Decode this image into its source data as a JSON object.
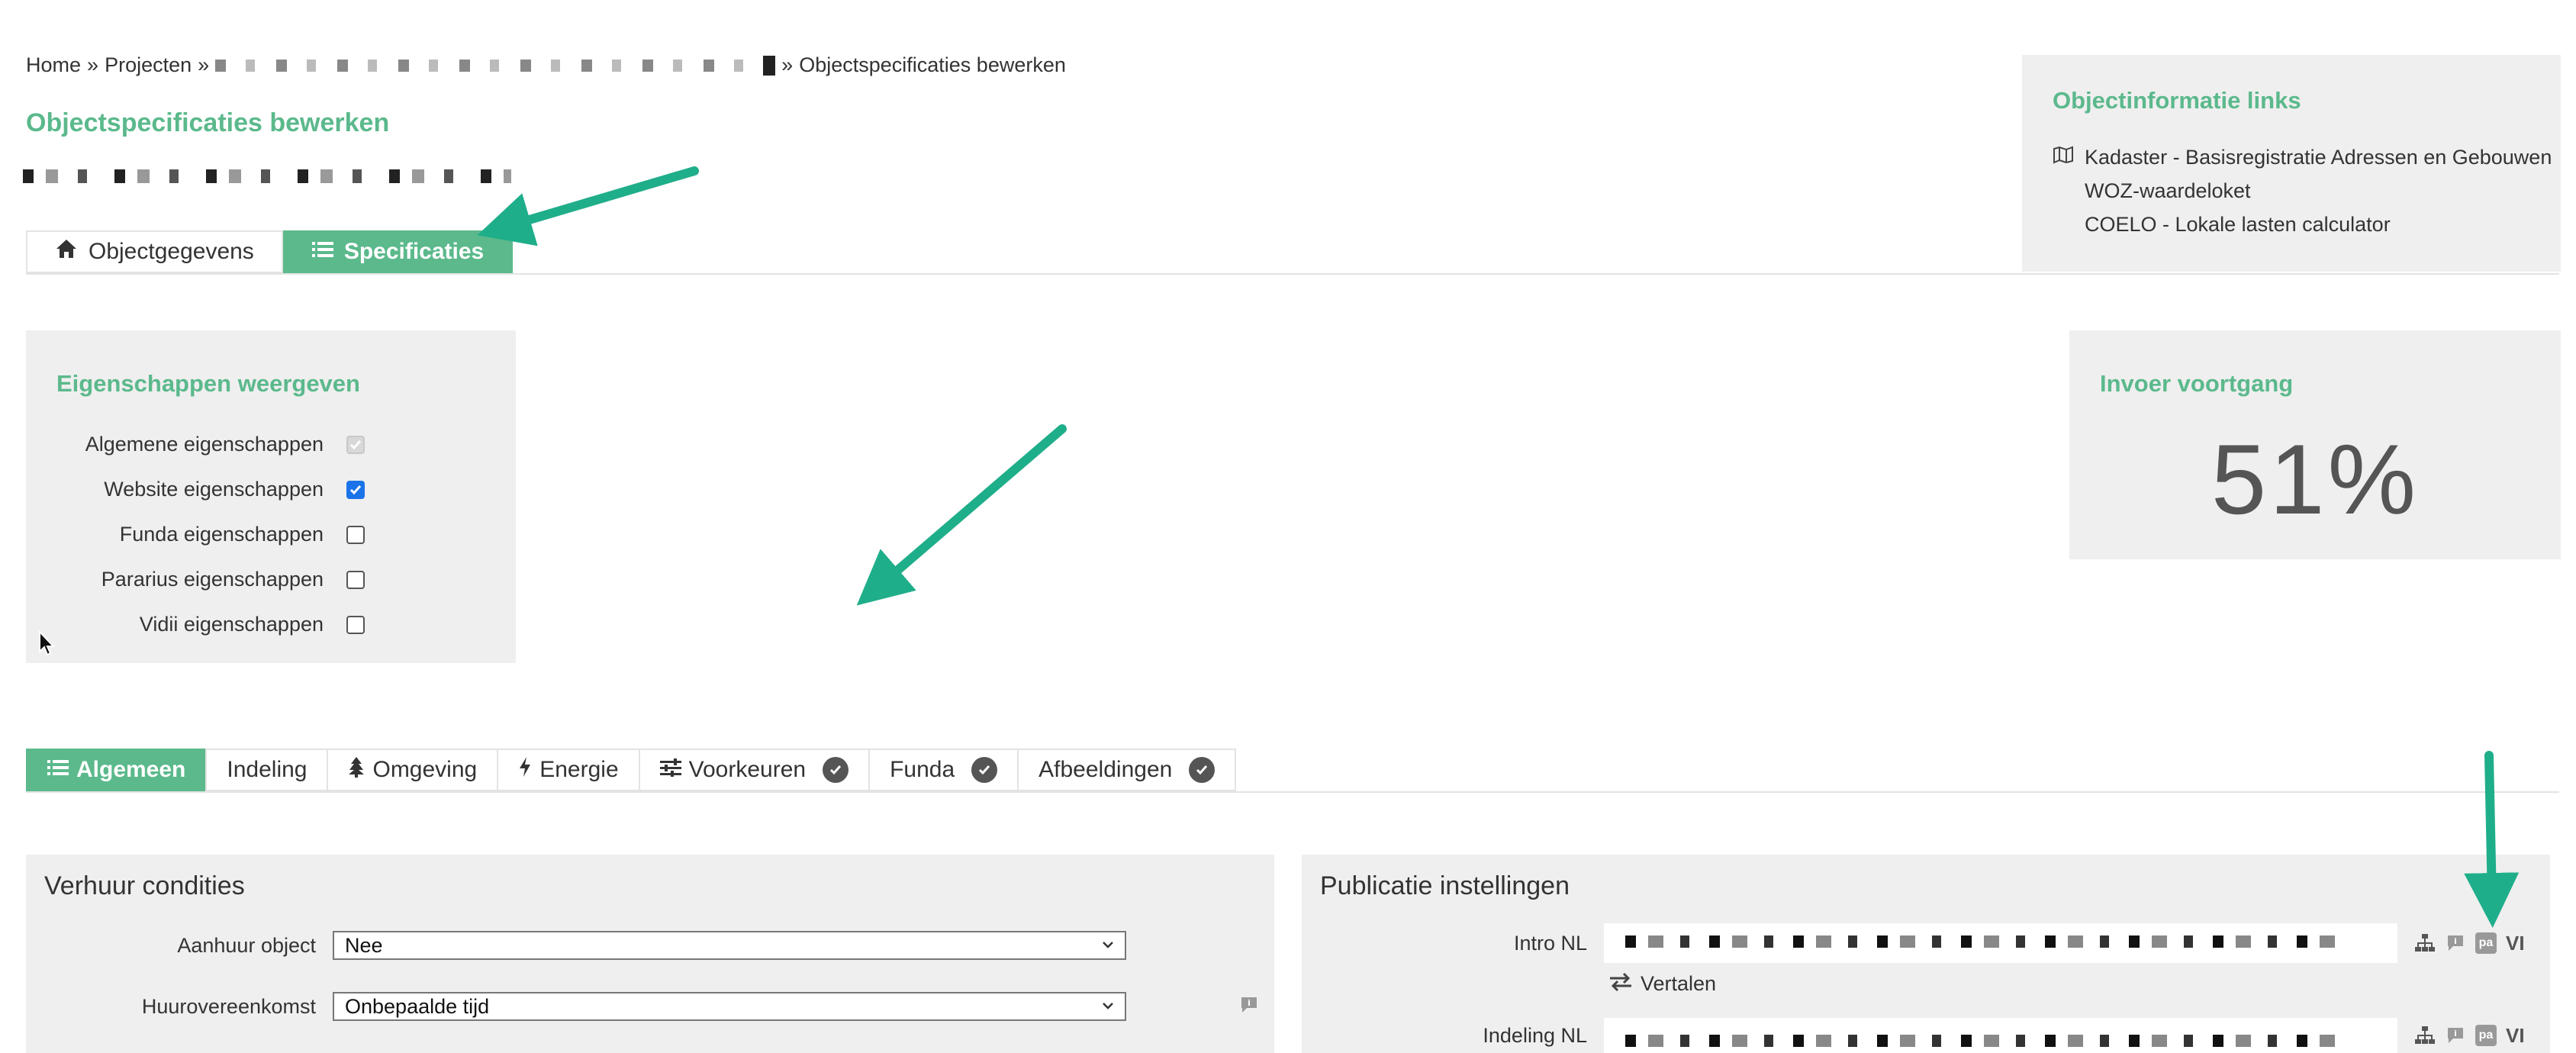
{
  "breadcrumb": {
    "home": "Home",
    "sep1": "»",
    "projects": "Projecten",
    "sep2": "»",
    "sep3": "»",
    "current": "Objectspecificaties bewerken"
  },
  "page": {
    "title": "Objectspecificaties bewerken"
  },
  "top_tabs": [
    {
      "label": "Objectgegevens",
      "icon": "home-icon",
      "active": false
    },
    {
      "label": "Specificaties",
      "icon": "list-icon",
      "active": true
    }
  ],
  "object_info": {
    "title": "Objectinformatie links",
    "links": [
      {
        "label": "Kadaster - Basisregistratie Adressen en Gebouwen",
        "icon": "map-icon"
      },
      {
        "label": "WOZ-waardeloket"
      },
      {
        "label": "COELO - Lokale lasten calculator"
      }
    ]
  },
  "properties": {
    "title": "Eigenschappen weergeven",
    "items": [
      {
        "label": "Algemene eigenschappen",
        "checked": true,
        "disabled": true
      },
      {
        "label": "Website eigenschappen",
        "checked": true,
        "disabled": false
      },
      {
        "label": "Funda eigenschappen",
        "checked": false,
        "disabled": false
      },
      {
        "label": "Pararius eigenschappen",
        "checked": false,
        "disabled": false
      },
      {
        "label": "Vidii eigenschappen",
        "checked": false,
        "disabled": false
      }
    ]
  },
  "progress": {
    "title": "Invoer voortgang",
    "value": "51%"
  },
  "bottom_tabs": [
    {
      "label": "Algemeen",
      "icon": "list-icon",
      "active": true,
      "complete": false
    },
    {
      "label": "Indeling",
      "active": false,
      "complete": false
    },
    {
      "label": "Omgeving",
      "icon": "tree-icon",
      "active": false,
      "complete": false
    },
    {
      "label": "Energie",
      "icon": "bolt-icon",
      "active": false,
      "complete": false
    },
    {
      "label": "Voorkeuren",
      "icon": "sliders-icon",
      "active": false,
      "complete": true
    },
    {
      "label": "Funda",
      "active": false,
      "complete": true
    },
    {
      "label": "Afbeeldingen",
      "active": false,
      "complete": true
    }
  ],
  "rental": {
    "title": "Verhuur condities",
    "fields": [
      {
        "label": "Aanhuur object",
        "value": "Nee"
      },
      {
        "label": "Huurovereenkomst",
        "value": "Onbepaalde tijd"
      }
    ]
  },
  "publication": {
    "title": "Publicatie instellingen",
    "intro_label": "Intro NL",
    "translate_label": "Vertalen",
    "layout_label": "Indeling NL",
    "badge_text": "pa",
    "vi_text": "VI"
  },
  "colors": {
    "accent": "#5bb98c",
    "arrow": "#1fae8a",
    "panel": "#efefef"
  }
}
